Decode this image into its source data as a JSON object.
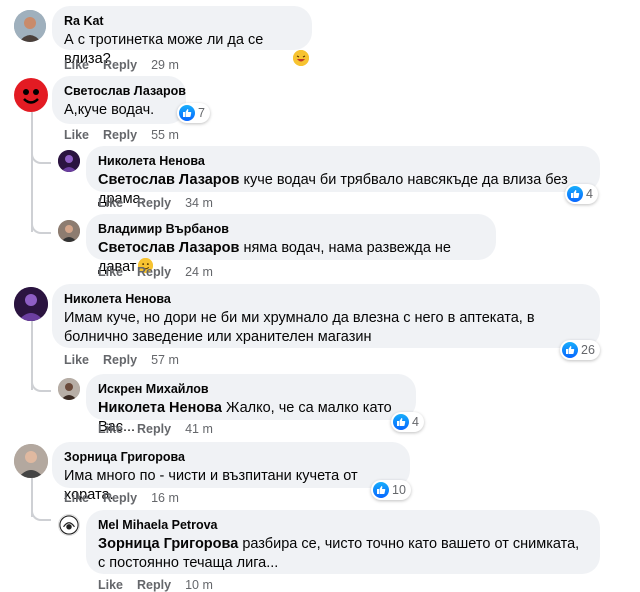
{
  "comments": [
    {
      "author": "Ra Kat",
      "text": "А с тротинетка може ли да се влиза?",
      "emoji": "face-emoji",
      "like": "Like",
      "reply": "Reply",
      "time": "29 m"
    },
    {
      "author": "Светослав Лазаров",
      "text": "А,куче водач.",
      "reactions": "7",
      "like": "Like",
      "reply": "Reply",
      "time": "55 m"
    },
    {
      "author": "Николета Ненова",
      "mention": "Светослав Лазаров",
      "text": " куче водач би трябвало навсякъде да влиза без драма.",
      "reactions": "4",
      "like": "Like",
      "reply": "Reply",
      "time": "34 m"
    },
    {
      "author": "Владимир Върбанов",
      "mention": "Светослав Лазаров",
      "text": " няма водач, нама развежда не дават",
      "emoji": "face-emoji",
      "like": "Like",
      "reply": "Reply",
      "time": "24 m"
    },
    {
      "author": "Николета Ненова",
      "text": "Имам куче, но дори не би ми хрумнало да влезна с него в аптеката, в болнично заведение или хранителен магазин",
      "reactions": "26",
      "like": "Like",
      "reply": "Reply",
      "time": "57 m"
    },
    {
      "author": "Искрен Михайлов",
      "mention": "Николета Ненова",
      "text": " Жалко, че са малко като Вас...",
      "reactions": "4",
      "like": "Like",
      "reply": "Reply",
      "time": "41 m"
    },
    {
      "author": "Зорница Григорова",
      "text": "Има много по - чисти и възпитани кучета от хората.",
      "reactions": "10",
      "like": "Like",
      "reply": "Reply",
      "time": "16 m"
    },
    {
      "author": "Mel Mihaela Petrova",
      "mention": "Зорница Григорова",
      "text": " разбира се, чисто точно като вашето от снимката, с постоянно течаща лига...",
      "like": "Like",
      "reply": "Reply",
      "time": "10 m"
    }
  ]
}
